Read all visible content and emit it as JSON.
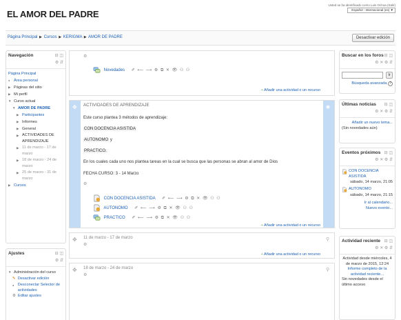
{
  "header": {
    "title": "EL AMOR DEL PADRE",
    "login_info": "Usted se ha identificado como Luis Ochoa (Salir)",
    "language": "Español - Internacional (es) ▼"
  },
  "navbar": {
    "breadcrumb": [
      "Página Principal",
      "Cursos",
      "KERIGMA",
      "AMOR DE PADRE"
    ],
    "edit_button": "Desactivar edición"
  },
  "nav_block": {
    "title": "Navegación",
    "items": {
      "home": "Página Principal",
      "personal": "Área personal",
      "site_pages": "Páginas del sitio",
      "profile": "Mi perfil",
      "current_course": "Curso actual",
      "course": "AMOR DE PADRE",
      "participants": "Participantes",
      "reports": "Informes",
      "general": "General",
      "activities": "ACTIVIDADES DE APRENDIZAJE",
      "week1": "11 de marzo - 17 de marzo",
      "week2": "18 de marzo - 24 de marzo",
      "week3": "25 de marzo - 31 de marzo",
      "courses": "Cursos"
    }
  },
  "settings_block": {
    "title": "Ajustes",
    "admin": "Administración del curso",
    "disable_edit": "Desactivar edición",
    "disconnect_selector": "Desconectar Selector de actividades",
    "edit_settings": "Editar ajustes"
  },
  "sections": {
    "general": {
      "news": "Novedades",
      "add_activity": "Añadir una actividad o un recurso"
    },
    "activities": {
      "title": "ACTIVIDADES DE APRENDIZAJE",
      "intro": "Este curso plantea 3 métodos de aprendizaje:",
      "method1": "CON DOCENCIA ASISTIDA",
      "method2": "AUTONOMO",
      "method2_suffix": " y",
      "method3": "PRACTICO.",
      "desc": "En los cuales cada uno nos plantea tareas en la cual se busca que las personas se abran al amor de Dios",
      "date": "FECHA CURSO: 3 - 14 Marzo",
      "res1": "CON DOCENCIA ASISTIDA",
      "res2": "AUTONOMO",
      "res3": "PRACTICO",
      "add_activity": "Añadir una actividad o un recurso"
    },
    "week1": {
      "title": "11 de marzo - 17 de marzo",
      "add_activity": "Añadir una actividad o un recurso"
    },
    "week2": {
      "title": "18 de marzo - 24 de marzo"
    }
  },
  "search_block": {
    "title": "Buscar en los foros",
    "button": "Ir",
    "advanced": "Búsqueda avanzada"
  },
  "news_block": {
    "title": "Últimas noticias",
    "add_topic": "Añadir un nuevo tema...",
    "no_news": "(Sin novedades aún)"
  },
  "events_block": {
    "title": "Eventos próximos",
    "event1_name": "CON DOCENCIA ASISTIDA",
    "event1_date": "sábado, 14 marzo, 21:05",
    "event2_name": "AUTONOMO",
    "event2_date": "sábado, 14 marzo, 21:15",
    "calendar": "Ir al calendario...",
    "new_event": "Nuevo evento..."
  },
  "recent_block": {
    "title": "Actividad reciente",
    "since": "Actividad desde miércoles, 4 de marzo de 2015, 12:24",
    "report": "Informe completo de la actividad reciente...",
    "no_news": "Sin novedades desde el último acceso"
  },
  "colors": {
    "link": "#1a5fb4",
    "section_highlight": "#c4dbf5"
  }
}
